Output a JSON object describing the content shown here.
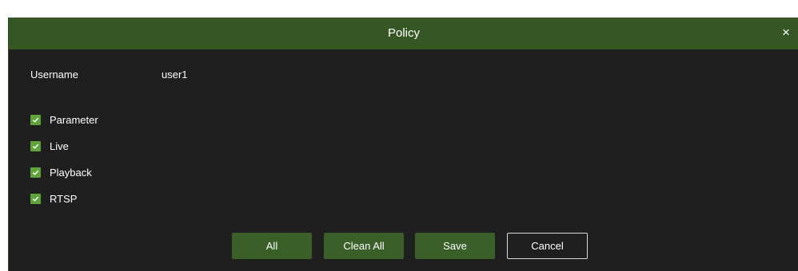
{
  "dialog": {
    "title": "Policy",
    "close_glyph": "×"
  },
  "user": {
    "label": "Username",
    "value": "user1"
  },
  "permissions": [
    {
      "label": "Parameter",
      "checked": true
    },
    {
      "label": "Live",
      "checked": true
    },
    {
      "label": "Playback",
      "checked": true
    },
    {
      "label": "RTSP",
      "checked": true
    }
  ],
  "buttons": {
    "all": "All",
    "clean_all": "Clean All",
    "save": "Save",
    "cancel": "Cancel"
  },
  "colors": {
    "titlebar": "#355724",
    "background": "#1f1f1f",
    "checkbox": "#5ea43a",
    "button": "#3b5f28"
  },
  "icons": {
    "close": "close-icon",
    "check": "check-icon"
  }
}
